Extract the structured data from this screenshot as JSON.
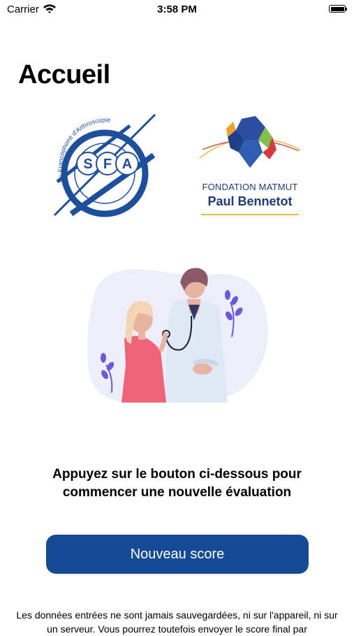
{
  "status_bar": {
    "carrier": "Carrier",
    "time": "3:58 PM",
    "wifi_icon": "wifi-icon",
    "battery_icon": "battery-icon"
  },
  "header": {
    "title": "Accueil"
  },
  "logos": {
    "sfa": {
      "ring_text": "Société Francophone d'Arthroscopie",
      "letters": [
        "S",
        "F",
        "A"
      ],
      "color": "#1d4f9c"
    },
    "matmut": {
      "line1": "FONDATION MATMUT",
      "line2": "Paul Bennetot",
      "color": "#1e3a7a"
    }
  },
  "illustration": {
    "name": "doctor-patient-illustration"
  },
  "main": {
    "prompt": "Appuyez sur le bouton ci-dessous pour commencer une nouvelle évaluation",
    "button_label": "Nouveau score",
    "disclaimer": "Les données entrées ne sont jamais sauvegardées, ni sur l'appareil, ni sur un serveur. Vous pourrez toutefois envoyer le score final par"
  },
  "colors": {
    "accent": "#174a94",
    "background": "#ffffff",
    "text": "#000000"
  }
}
